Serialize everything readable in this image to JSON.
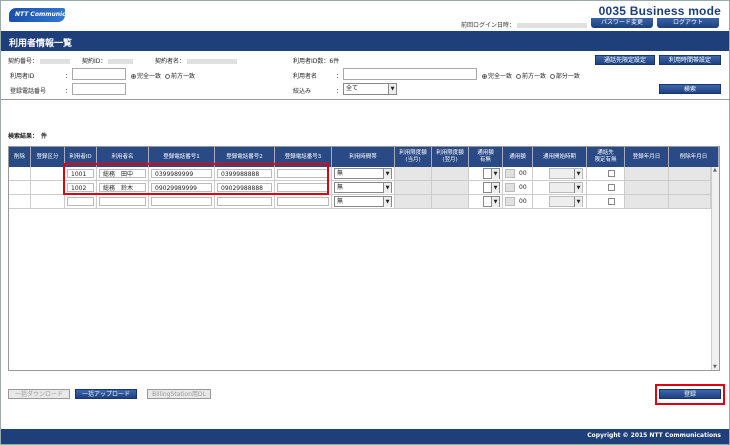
{
  "header": {
    "logo_text": "NTT Communications",
    "brand": "0035 Business mode",
    "last_login_label": "前回ログイン日時：",
    "password_change": "パスワード変更",
    "logout": "ログアウト"
  },
  "title": "利用者情報一覧",
  "info": {
    "contract_no": "契約番号：",
    "contract_id": "契約ID：",
    "contract_name": "契約者名：",
    "user_count": "利用者ID数：6件"
  },
  "top_buttons": {
    "dest_limit": "通話先限定設定",
    "time_setting": "利用時間帯設定"
  },
  "search": {
    "user_id_label": "利用者ID",
    "phone_label": "登録電話番号",
    "user_name_label": "利用者名",
    "filter_label": "絞込み",
    "colon": "：",
    "match_exact": "完全一致",
    "match_prefix": "前方一致",
    "match_partial": "部分一致",
    "filter_value": "全て",
    "search_button": "検索"
  },
  "result_label": "検索結果：　件",
  "columns": [
    "削除",
    "登録区分",
    "利用者ID",
    "利用者名",
    "登録電話番号1",
    "登録電話番号2",
    "登録電話番号3",
    "利用時間帯",
    "利用限度額\n(当月)",
    "利用限度額\n(翌月)",
    "通用額\n有無",
    "通用額",
    "通用開始時期",
    "通話先\n限定有無",
    "登録年月日",
    "削除年月日"
  ],
  "rows": [
    {
      "id": "1001",
      "name": "総務　田中",
      "phone1": "0399989999",
      "phone2": "0399988888",
      "phone3": "",
      "time": "無",
      "amount": "00"
    },
    {
      "id": "1002",
      "name": "総務　鈴木",
      "phone1": "09029989999",
      "phone2": "09029988888",
      "phone3": "",
      "time": "無",
      "amount": "00"
    },
    {
      "id": "",
      "name": "",
      "phone1": "",
      "phone2": "",
      "phone3": "",
      "time": "無",
      "amount": "00"
    }
  ],
  "bottom": {
    "bulk_download": "一括ダウンロード",
    "bulk_upload": "一括アップロード",
    "billing_dl": "BillingStation用DL",
    "register": "登録"
  },
  "footer": "Copyright © 2015 NTT Communications"
}
